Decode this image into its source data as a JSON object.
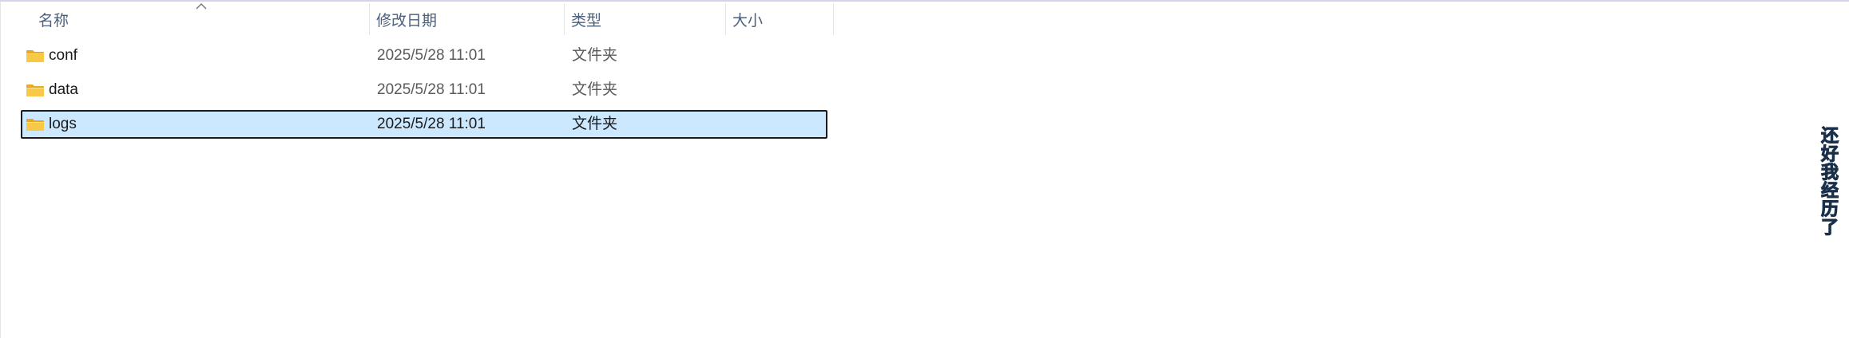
{
  "columns": {
    "name": "名称",
    "modified": "修改日期",
    "type": "类型",
    "size": "大小"
  },
  "sort": {
    "column": "name",
    "icon": "sort-ascending-caret-icon"
  },
  "files": [
    {
      "name": "conf",
      "modified": "2025/5/28 11:01",
      "type": "文件夹",
      "icon": "folder-icon",
      "selected": false
    },
    {
      "name": "data",
      "modified": "2025/5/28 11:01",
      "type": "文件夹",
      "icon": "folder-icon",
      "selected": false
    },
    {
      "name": "logs",
      "modified": "2025/5/28 11:01",
      "type": "文件夹",
      "icon": "folder-icon",
      "selected": true
    }
  ],
  "overlay_caption": "还好我经历了",
  "colors": {
    "selection_fill": "#cce8ff",
    "selection_border": "#1b1b1b",
    "header_text": "#4c607a",
    "folder_yellow": "#f8c847"
  }
}
